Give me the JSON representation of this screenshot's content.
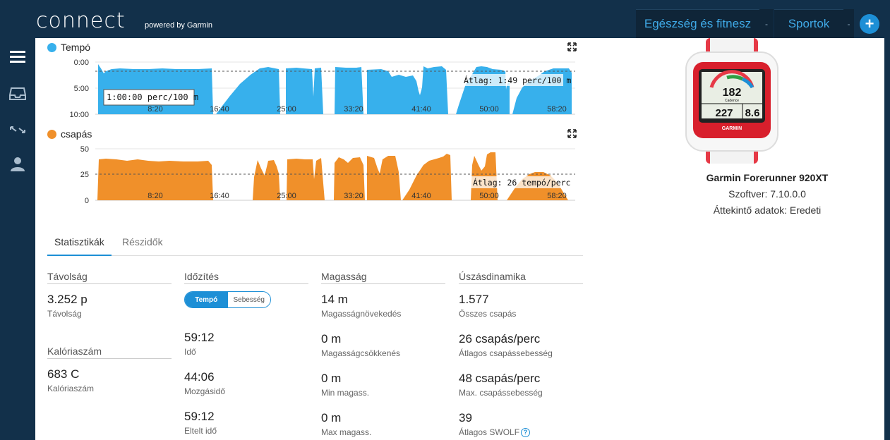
{
  "header": {
    "logo": "connect",
    "logo_sub": "powered by Garmin",
    "nav_health": "Egészség és fitnesz",
    "nav_sports": "Sportok",
    "nav_sep": "-",
    "plus": "+"
  },
  "sidebar": {
    "icons": [
      "menu-icon",
      "inbox-icon",
      "arrows-icon",
      "user-icon"
    ]
  },
  "colors": {
    "pace": "#37b0ec",
    "stroke": "#f0902a",
    "accent": "#1d8fd6"
  },
  "charts": {
    "pace": {
      "legend": "Tempó",
      "y_ticks": [
        "0:00",
        "5:00",
        "10:00"
      ],
      "x_ticks": [
        "8:20",
        "16:40",
        "25:00",
        "33:20",
        "41:40",
        "50:00",
        "58:20"
      ],
      "tooltip": "1:00:00 perc/100 m",
      "avg_label": "Átlag: 1:49 perc/100 m"
    },
    "stroke": {
      "legend": "csapás",
      "y_ticks": [
        "50",
        "25",
        "0"
      ],
      "x_ticks": [
        "8:20",
        "16:40",
        "25:00",
        "33:20",
        "41:40",
        "50:00",
        "58:20"
      ],
      "avg_label": "Átlag: 26 tempó/perc"
    }
  },
  "chart_data": [
    {
      "type": "area",
      "x_ticks": [
        "8:20",
        "16:40",
        "25:00",
        "33:20",
        "41:40",
        "50:00",
        "58:20"
      ],
      "y_ticks": [
        "0:00",
        "5:00",
        "10:00"
      ],
      "y_inverted": true,
      "x": [
        "0:00",
        "8:20",
        "16:40",
        "20:00",
        "25:00",
        "33:20",
        "41:40",
        "50:00",
        "55:00",
        "58:20"
      ],
      "values": [
        "1:40",
        "1:45",
        "1:40",
        "8:00",
        "1:30",
        "1:35",
        "2:00",
        "1:30",
        "3:00",
        "1:50"
      ],
      "average": "1:49"
    },
    {
      "type": "area",
      "x_ticks": [
        "8:20",
        "16:40",
        "25:00",
        "33:20",
        "41:40",
        "50:00",
        "58:20"
      ],
      "y_ticks": [
        "50",
        "25",
        "0"
      ],
      "x": [
        "0:00",
        "8:20",
        "16:40",
        "20:00",
        "25:00",
        "33:20",
        "41:40",
        "50:00",
        "55:00",
        "58:20"
      ],
      "values": [
        38,
        37,
        36,
        0,
        38,
        37,
        42,
        44,
        25,
        5
      ],
      "ylim": [
        0,
        50
      ],
      "average": 26
    }
  ],
  "tabs": {
    "stats": "Statisztikák",
    "splits": "Részidők"
  },
  "stats": {
    "distance": {
      "head": "Távolság",
      "value": "3.252 p",
      "label": "Távolság"
    },
    "calories": {
      "head": "Kalóriaszám",
      "value": "683 C",
      "label": "Kalóriaszám"
    },
    "timing": {
      "head": "Időzítés",
      "toggle_on": "Tempó",
      "toggle_off": "Sebesség",
      "time_value": "59:12",
      "time_label": "Idő",
      "moving_value": "44:06",
      "moving_label": "Mozgásidő",
      "elapsed_value": "59:12",
      "elapsed_label": "Eltelt idő"
    },
    "elevation": {
      "head": "Magasság",
      "gain_value": "14 m",
      "gain_label": "Magasságnövekedés",
      "loss_value": "0 m",
      "loss_label": "Magasságcsökkenés",
      "min_value": "0 m",
      "min_label": "Min magass.",
      "max_value": "0 m",
      "max_label": "Max magass."
    },
    "swim": {
      "head": "Úszásdinamika",
      "strokes_value": "1.577",
      "strokes_label": "Összes csapás",
      "avg_rate_value": "26 csapás/perc",
      "avg_rate_label": "Átlagos csapássebesség",
      "max_rate_value": "48 csapás/perc",
      "max_rate_label": "Max. csapássebesség",
      "swolf_value": "39",
      "swolf_label": "Átlagos SWOLF",
      "help": "?"
    }
  },
  "device": {
    "name": "Garmin Forerunner 920XT",
    "software": "Szoftver: 7.10.0.0",
    "summary": "Áttekintő adatok: Eredeti",
    "screen_main": "182",
    "screen_sub": "Cadence",
    "screen_left": "227",
    "screen_right": "8.6",
    "brand": "GARMIN"
  }
}
